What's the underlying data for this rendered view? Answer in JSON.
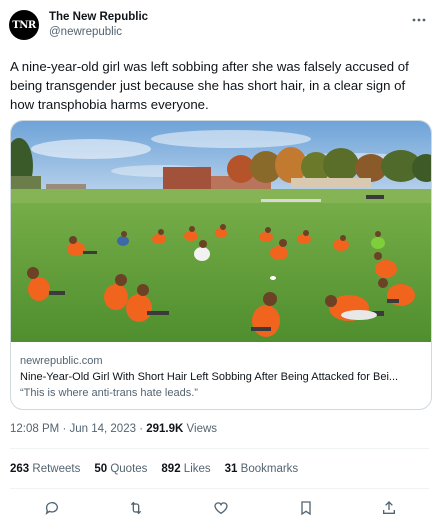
{
  "author": {
    "avatar_text": "TNR",
    "display_name": "The New Republic",
    "handle": "@newrepublic"
  },
  "tweet_text": "A nine-year-old girl was left sobbing after she was falsely accused of being transgender just because she has short hair, in a clear sign of how transphobia harms everyone.",
  "card": {
    "domain": "newrepublic.com",
    "title": "Nine-Year-Old Girl With Short Hair Left Sobbing After Being Attacked for Bei...",
    "description": "“This is where anti-trans hate leads.”"
  },
  "meta": {
    "time": "12:08 PM",
    "date": "Jun 14, 2023",
    "views_count": "291.9K",
    "views_label": "Views",
    "separator": "·"
  },
  "stats": {
    "retweets_count": "263",
    "retweets_label": "Retweets",
    "quotes_count": "50",
    "quotes_label": "Quotes",
    "likes_count": "892",
    "likes_label": "Likes",
    "bookmarks_count": "31",
    "bookmarks_label": "Bookmarks"
  },
  "icons": {
    "more": "more-options-icon",
    "reply": "reply-icon",
    "retweet": "retweet-icon",
    "like": "heart-icon",
    "bookmark": "bookmark-icon",
    "share": "share-icon"
  },
  "colors": {
    "text_primary": "#0f1419",
    "text_secondary": "#536471",
    "border": "#cfd9de",
    "shirt_orange": "#f0641e",
    "grass": "#5b9a38"
  }
}
